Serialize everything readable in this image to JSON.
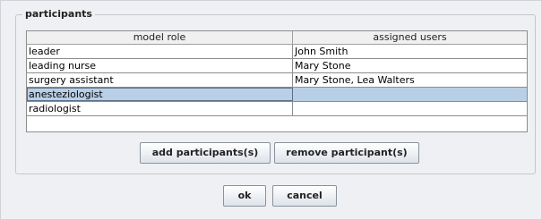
{
  "participants": {
    "title": "participants",
    "columns": [
      "model role",
      "assigned users"
    ],
    "rows": [
      {
        "role": "leader",
        "users": "John Smith"
      },
      {
        "role": "leading nurse",
        "users": "Mary Stone"
      },
      {
        "role": "surgery assistant",
        "users": "Mary Stone, Lea Walters"
      },
      {
        "role": "anesteziologist",
        "users": ""
      },
      {
        "role": "radiologist",
        "users": ""
      }
    ],
    "selected_row": "anesteziologist",
    "add_label": "add participants(s)",
    "remove_label": "remove participant(s)"
  },
  "dialog": {
    "ok_label": "ok",
    "cancel_label": "cancel"
  },
  "colors": {
    "selection": "#b8cfe5",
    "panel": "#eef0f3"
  }
}
